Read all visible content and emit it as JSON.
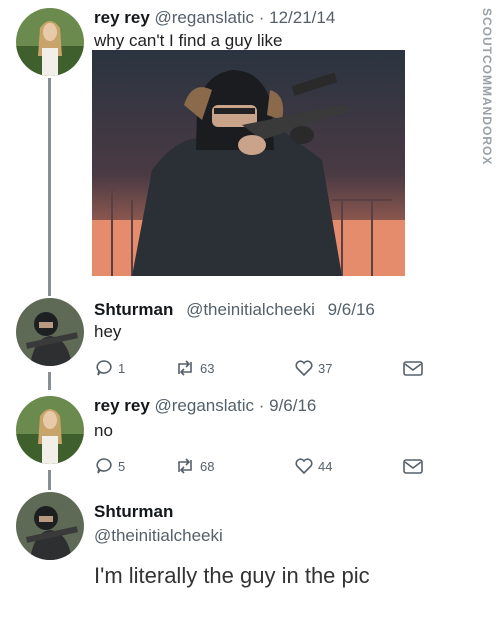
{
  "watermark": "SCOUTCOMMANDOROX",
  "tweets": [
    {
      "name": "rey rey",
      "handle": "@reganslatic",
      "date": "12/21/14",
      "text": "why can't I find a guy like",
      "avatar_icon": "blonde-woman-avatar",
      "media_icon": "armed-soldier-photo"
    },
    {
      "name": "Shturman",
      "handle": "@theinitialcheeki",
      "date": "9/6/16",
      "text": "hey",
      "avatar_icon": "armed-soldier-avatar",
      "replies": "1",
      "retweets": "63",
      "likes": "37"
    },
    {
      "name": "rey rey",
      "handle": "@reganslatic",
      "date": "9/6/16",
      "text": "no",
      "avatar_icon": "blonde-woman-avatar",
      "replies": "5",
      "retweets": "68",
      "likes": "44"
    },
    {
      "name": "Shturman",
      "handle": "@theinitialcheeki",
      "text": "I'm literally the guy in the pic",
      "avatar_icon": "armed-soldier-avatar"
    }
  ],
  "separator": "·"
}
